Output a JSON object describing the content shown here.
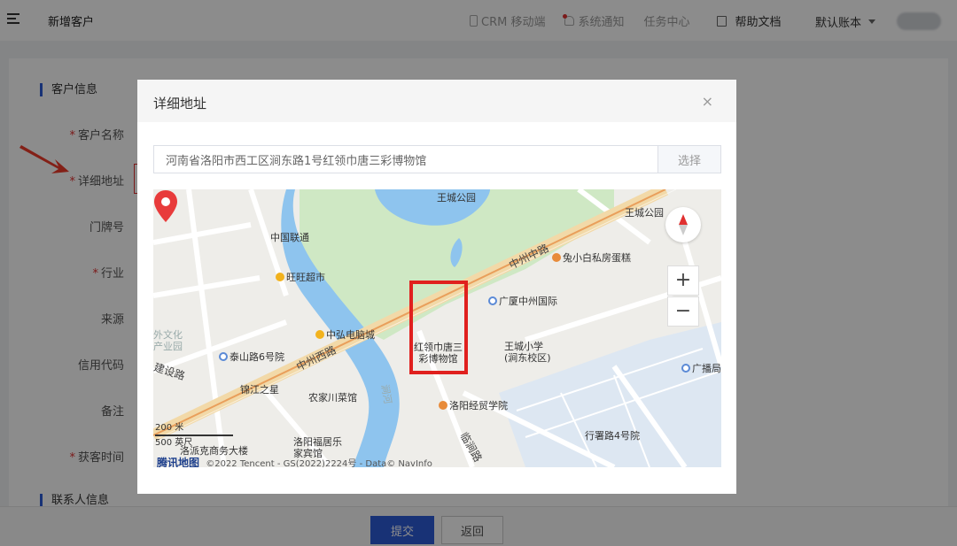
{
  "header": {
    "page_title": "新增客户",
    "links": [
      {
        "label": "CRM 移动端",
        "icon": "mobile-icon"
      },
      {
        "label": "系统通知",
        "icon": "bell-icon"
      },
      {
        "label": "任务中心"
      },
      {
        "label": "帮助文档",
        "icon": "document-icon"
      }
    ],
    "account_label": "默认账本"
  },
  "form": {
    "section_customer": "客户信息",
    "fields": [
      {
        "label": "客户名称",
        "required": "*"
      },
      {
        "label": "详细地址",
        "required": "*"
      },
      {
        "label": "门牌号",
        "required": ""
      },
      {
        "label": "行业",
        "required": "*"
      },
      {
        "label": "来源",
        "required": ""
      },
      {
        "label": "信用代码",
        "required": ""
      },
      {
        "label": "备注",
        "required": ""
      },
      {
        "label": "获客时间",
        "required": "*"
      }
    ],
    "section_contact": "联系人信息"
  },
  "footer": {
    "submit_label": "提交",
    "back_label": "返回"
  },
  "modal": {
    "title": "详细地址",
    "close_label": "×",
    "address_value": "河南省洛阳市西工区涧东路1号红领巾唐三彩博物馆",
    "select_label": "选择",
    "map": {
      "labels": {
        "wangcheng_park": "王城公园",
        "wangcheng_park_2": "王城公园",
        "china_unicom": "中国联通",
        "wangwang": "旺旺超市",
        "zhongzhou_mid_road": "中州中路",
        "rabbit_cake": "兔小白私房蛋糕",
        "guangsha": "广厦中州国际",
        "zhonghong": "中弘电脑城",
        "selected_poi": "红领巾唐三\n彩博物馆",
        "wangcheng_school": "王城小学\n(涧东校区)",
        "outer_culture": "外文化\n产业园",
        "taishan_road": "泰山路6号院",
        "zhongzhou_west_road": "中州西路",
        "jinjiang": "锦江之星",
        "nongjia": "农家川菜馆",
        "luoyang_college": "洛阳经贸学院",
        "guangbo": "广播局",
        "xingshu": "行署路4号院",
        "luoyang_fuju": "洛阳福居乐\n家宾馆",
        "luopai": "洛派克商务大楼",
        "jianhe": "涧河",
        "construction_road": "建设路",
        "linjian_road": "临涧路"
      },
      "scale_metric": "200 米",
      "scale_imperial": "500 英尺",
      "brand": "腾讯地图",
      "copyright": "©2022 Tencent - GS(2022)2224号 - Data© NavInfo",
      "zoom_in": "+",
      "zoom_out": "−"
    }
  },
  "colors": {
    "primary": "#2d5bd8",
    "required": "#e03030",
    "highlight": "#e0201e",
    "park": "#cfe8c4",
    "river": "#8ec4ee"
  }
}
